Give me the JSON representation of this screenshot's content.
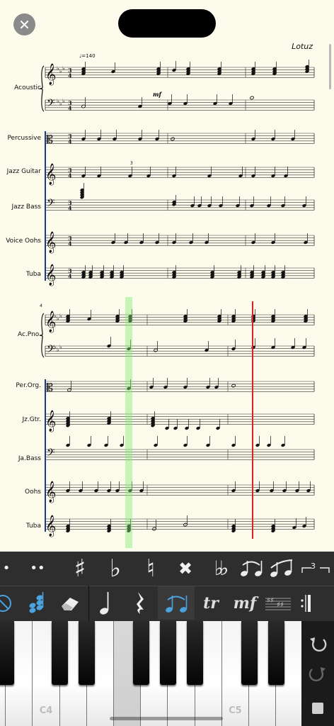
{
  "score": {
    "composer": "Lotuz",
    "tempo_mark": "♩=140",
    "dynamic": "mf",
    "tuplet": "3",
    "measure_number": "4",
    "system1_instruments": [
      "Acoustic",
      "Percussive",
      "Jazz Guitar",
      "Jazz Bass",
      "Voice Oohs",
      "Tuba"
    ],
    "system2_instruments": [
      "Ac.Pno.",
      "Per.Org.",
      "Jz.Gtr.",
      "Ja.Bass",
      "Oohs",
      "Tuba"
    ]
  },
  "toolbar": {
    "row1": [
      {
        "name": "dot-button",
        "glyph": "•"
      },
      {
        "name": "double-dot-button",
        "glyph": "••"
      },
      {
        "name": "sharp-button",
        "glyph": "♯"
      },
      {
        "name": "flat-button",
        "glyph": "♭"
      },
      {
        "name": "natural-button",
        "glyph": "♮"
      },
      {
        "name": "double-sharp-button",
        "glyph": "✖"
      },
      {
        "name": "double-flat-button",
        "glyph": "♭♭"
      },
      {
        "name": "tie-button",
        "glyph": ""
      },
      {
        "name": "slur-button",
        "glyph": ""
      },
      {
        "name": "tuplet-button",
        "glyph": "3"
      }
    ],
    "tuplet_label": "3",
    "ornament_label": "tr",
    "dynamic_label": "mf",
    "accent_color": "#4aa3df"
  },
  "keyboard": {
    "c4_label": "C4",
    "c5_label": "C5"
  }
}
